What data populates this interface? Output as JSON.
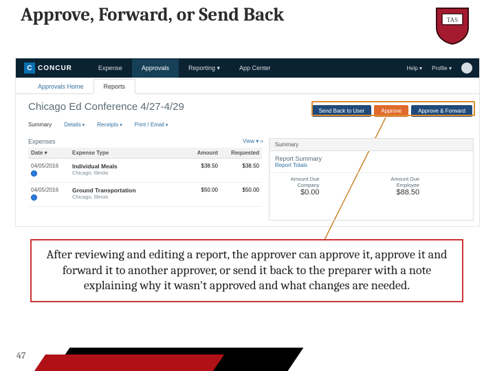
{
  "slide": {
    "title": "Approve, Forward, or Send Back",
    "page_number": "47"
  },
  "app": {
    "brand": "CONCUR",
    "menu": {
      "expense": "Expense",
      "approvals": "Approvals",
      "reporting": "Reporting ▾",
      "appcenter": "App Center"
    },
    "help": "Help ▾",
    "profile": "Profile ▾"
  },
  "subnav": {
    "home": "Approvals Home",
    "reports": "Reports"
  },
  "report": {
    "title": "Chicago Ed Conference 4/27-4/29",
    "actions": {
      "send_back": "Send Back to User",
      "approve": "Approve",
      "approve_forward": "Approve & Forward"
    },
    "tabs": {
      "summary": "Summary",
      "details": "Details",
      "receipts": "Receipts",
      "print": "Print / Email"
    },
    "expenses_label": "Expenses",
    "view_label": "View ▾  «",
    "columns": {
      "date": "Date ▾",
      "type": "Expense Type",
      "amount": "Amount",
      "requested": "Requested"
    },
    "rows": [
      {
        "date": "04/05/2016",
        "type": "Individual Meals",
        "loc": "Chicago, Illinois",
        "amount": "$38.50",
        "requested": "$38.50"
      },
      {
        "date": "04/05/2016",
        "type": "Ground Transportation",
        "loc": "Chicago, Illinois",
        "amount": "$50.00",
        "requested": "$50.00"
      }
    ]
  },
  "summary": {
    "head": "Summary",
    "title": "Report Summary",
    "link": "Report Totals",
    "due_company_label": "Amount Due Company",
    "due_company_val": "$0.00",
    "due_employee_label": "Amount Due Employee",
    "due_employee_val": "$88.50"
  },
  "caption": "After reviewing and editing a report, the approver can approve it, approve it and forward it to another approver, or send it back to the preparer with a note explaining why it wasn't approved and what changes are needed."
}
